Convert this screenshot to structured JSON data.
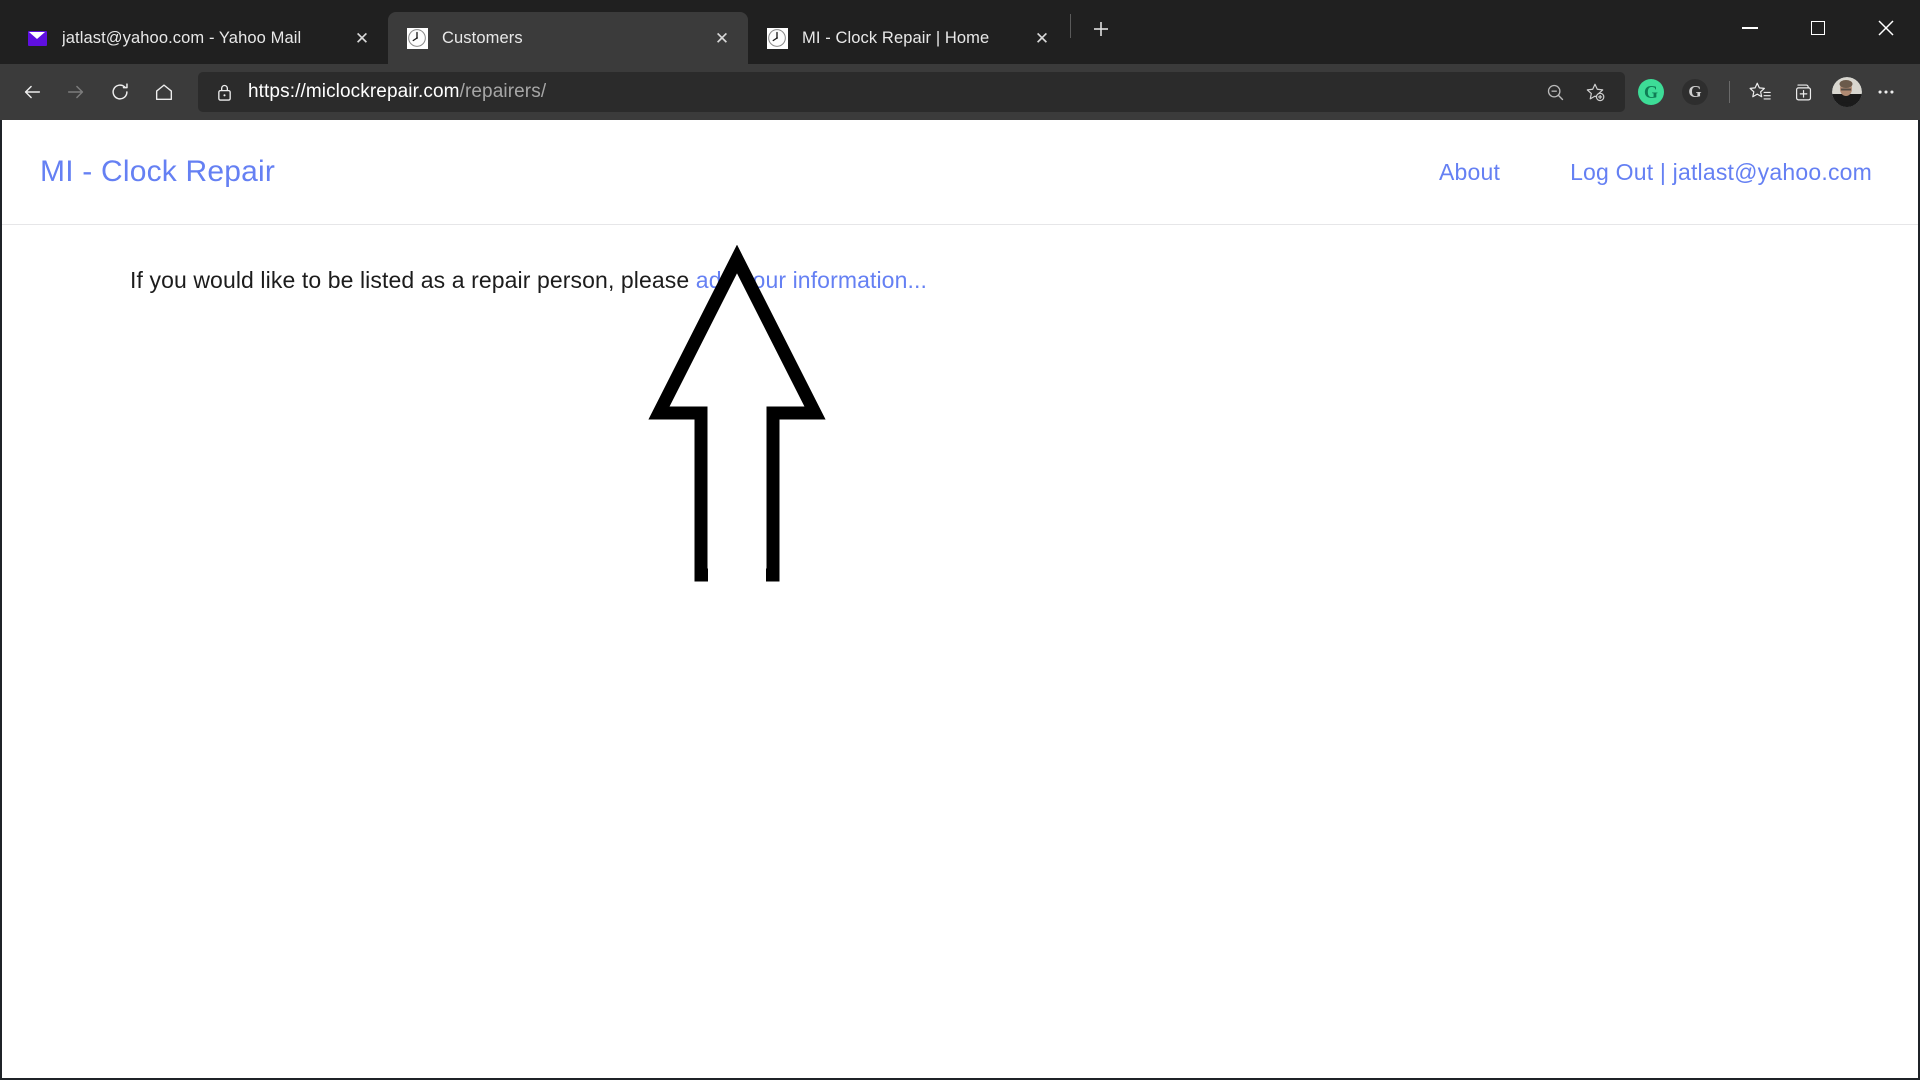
{
  "window": {
    "controls": {
      "minimize": "minimize-button",
      "maximize": "maximize-button",
      "close": "close-button"
    }
  },
  "tabs": [
    {
      "title": "jatlast@yahoo.com - Yahoo Mail",
      "favicon": "envelope-icon",
      "active": false,
      "close_label": "✕"
    },
    {
      "title": "Customers",
      "favicon": "clock-icon",
      "active": true,
      "close_label": "✕"
    },
    {
      "title": "MI - Clock Repair | Home",
      "favicon": "clock-icon",
      "active": false,
      "close_label": "✕"
    }
  ],
  "newtab": {
    "label": "+"
  },
  "toolbar": {
    "back": "back-arrow-icon",
    "forward": "forward-arrow-icon",
    "refresh": "refresh-icon",
    "home": "home-icon",
    "lock": "lock-icon",
    "url_secure": "https://miclockrepair.com",
    "url_path": "/repairers/",
    "zoom_out": "zoom-out-icon",
    "add_favorite": "add-favorite-icon",
    "grammarly": "G",
    "grammarly_alt": "G",
    "favorites": "favorites-icon",
    "collections": "collections-icon",
    "profile": "profile-avatar",
    "settings_more": "⋯"
  },
  "page": {
    "brand": "MI - Clock Repair",
    "nav": [
      {
        "label": "About"
      },
      {
        "label": "Log Out | jatlast@yahoo.com"
      }
    ],
    "lead_prefix": "If you would like to be listed as a repair person, please ",
    "lead_link": "add your information...",
    "annotation": "up-arrow-annotation"
  },
  "colors": {
    "chrome_dark": "#202020",
    "toolbar": "#3b3b3b",
    "tab_active": "#3b3b3b",
    "omnibox": "#2b2b2b",
    "link_blue": "#6580f3",
    "page_bg": "#ffffff",
    "grammarly_green": "#3ddc97"
  }
}
